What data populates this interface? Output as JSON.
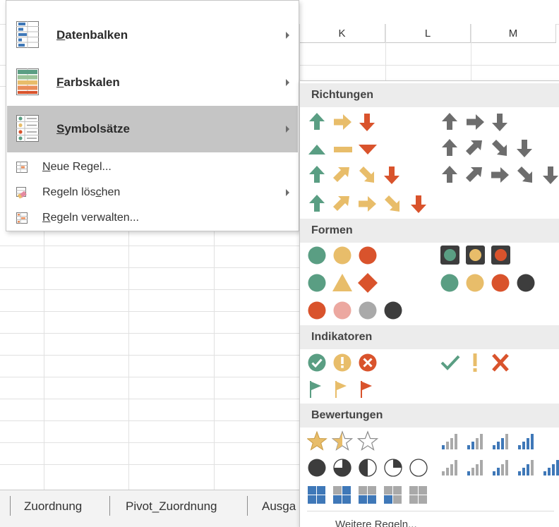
{
  "columns": [
    "K",
    "L",
    "M"
  ],
  "menu": {
    "items": [
      {
        "label_pre": "",
        "label_u": "D",
        "label_post": "atenbalken",
        "icon": "data-bars-icon",
        "has_submenu": true
      },
      {
        "label_pre": "",
        "label_u": "F",
        "label_post": "arbskalen",
        "icon": "color-scales-icon",
        "has_submenu": true
      },
      {
        "label_pre": "",
        "label_u": "S",
        "label_post": "ymbolsätze",
        "icon": "icon-sets-icon",
        "has_submenu": true,
        "active": true
      }
    ],
    "small_items": [
      {
        "label_pre": "",
        "label_u": "N",
        "label_post": "eue Regel...",
        "icon": "new-rule-icon",
        "has_submenu": false
      },
      {
        "label_pre": "Regeln lös",
        "label_u": "c",
        "label_post": "hen",
        "icon": "clear-rules-icon",
        "has_submenu": true
      },
      {
        "label_pre": "",
        "label_u": "R",
        "label_post": "egeln verwalten...",
        "icon": "manage-rules-icon",
        "has_submenu": false
      }
    ]
  },
  "gallery": {
    "sections": [
      "Richtungen",
      "Formen",
      "Indikatoren",
      "Bewertungen"
    ],
    "more_label": "Weitere Regeln..."
  },
  "sheet_tabs": [
    "Zuordnung",
    "Pivot_Zuordnung",
    "Ausga"
  ],
  "colors": {
    "green": "#5a9e83",
    "yellow": "#e8bd6a",
    "red": "#d9532c",
    "gray": "#6d6d6d",
    "blue": "#3f78b8",
    "menu_active": "#c5c5c5"
  }
}
